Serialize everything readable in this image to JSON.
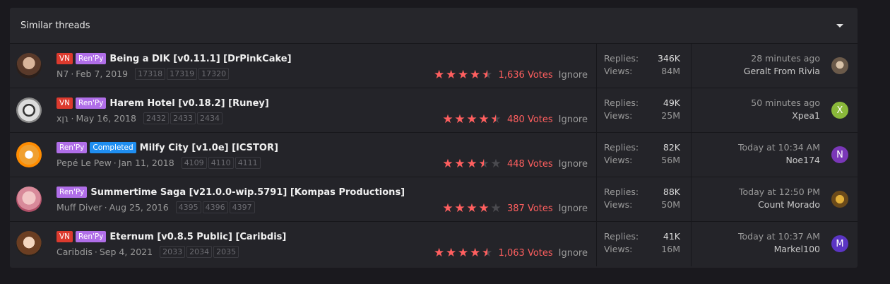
{
  "block": {
    "title": "Similar threads",
    "collapse_icon": "chevron-down-icon"
  },
  "threads": [
    {
      "labels": [
        "VN",
        "Ren'Py"
      ],
      "title": "Being a DIK [v0.11.1] [DrPinkCake]",
      "author": "N7",
      "date": "Feb 7, 2019",
      "pages": [
        "17318",
        "17319",
        "17320"
      ],
      "rating": 4.5,
      "votes": "1,636 Votes",
      "ignore": "Ignore",
      "replies_label": "Replies:",
      "replies": "346K",
      "views_label": "Views:",
      "views": "84M",
      "last_date": "28 minutes ago",
      "last_user": "Geralt From Rivia",
      "last_avatar_letter": ""
    },
    {
      "labels": [
        "VN",
        "Ren'Py"
      ],
      "title": "Harem Hotel [v0.18.2] [Runey]",
      "author": "xꞁɿ",
      "date": "May 16, 2018",
      "pages": [
        "2432",
        "2433",
        "2434"
      ],
      "rating": 4.5,
      "votes": "480 Votes",
      "ignore": "Ignore",
      "replies_label": "Replies:",
      "replies": "49K",
      "views_label": "Views:",
      "views": "25M",
      "last_date": "50 minutes ago",
      "last_user": "Xpea1",
      "last_avatar_letter": "X"
    },
    {
      "labels": [
        "Ren'Py",
        "Completed"
      ],
      "title": "Milfy City [v1.0e] [ICSTOR]",
      "author": "Pepé Le Pew",
      "date": "Jan 11, 2018",
      "pages": [
        "4109",
        "4110",
        "4111"
      ],
      "rating": 3.5,
      "votes": "448 Votes",
      "ignore": "Ignore",
      "replies_label": "Replies:",
      "replies": "82K",
      "views_label": "Views:",
      "views": "56M",
      "last_date": "Today at 10:34 AM",
      "last_user": "Noe174",
      "last_avatar_letter": "N"
    },
    {
      "labels": [
        "Ren'Py"
      ],
      "title": "Summertime Saga [v21.0.0-wip.5791] [Kompas Productions]",
      "author": "Muff Diver",
      "date": "Aug 25, 2016",
      "pages": [
        "4395",
        "4396",
        "4397"
      ],
      "rating": 4,
      "votes": "387 Votes",
      "ignore": "Ignore",
      "replies_label": "Replies:",
      "replies": "88K",
      "views_label": "Views:",
      "views": "50M",
      "last_date": "Today at 12:50 PM",
      "last_user": "Count Morado",
      "last_avatar_letter": ""
    },
    {
      "labels": [
        "VN",
        "Ren'Py"
      ],
      "title": "Eternum [v0.8.5 Public] [Caribdis]",
      "author": "Caribdis",
      "date": "Sep 4, 2021",
      "pages": [
        "2033",
        "2034",
        "2035"
      ],
      "rating": 4.5,
      "votes": "1,063 Votes",
      "ignore": "Ignore",
      "replies_label": "Replies:",
      "replies": "41K",
      "views_label": "Views:",
      "views": "16M",
      "last_date": "Today at 10:37 AM",
      "last_user": "Markel100",
      "last_avatar_letter": "M"
    }
  ]
}
